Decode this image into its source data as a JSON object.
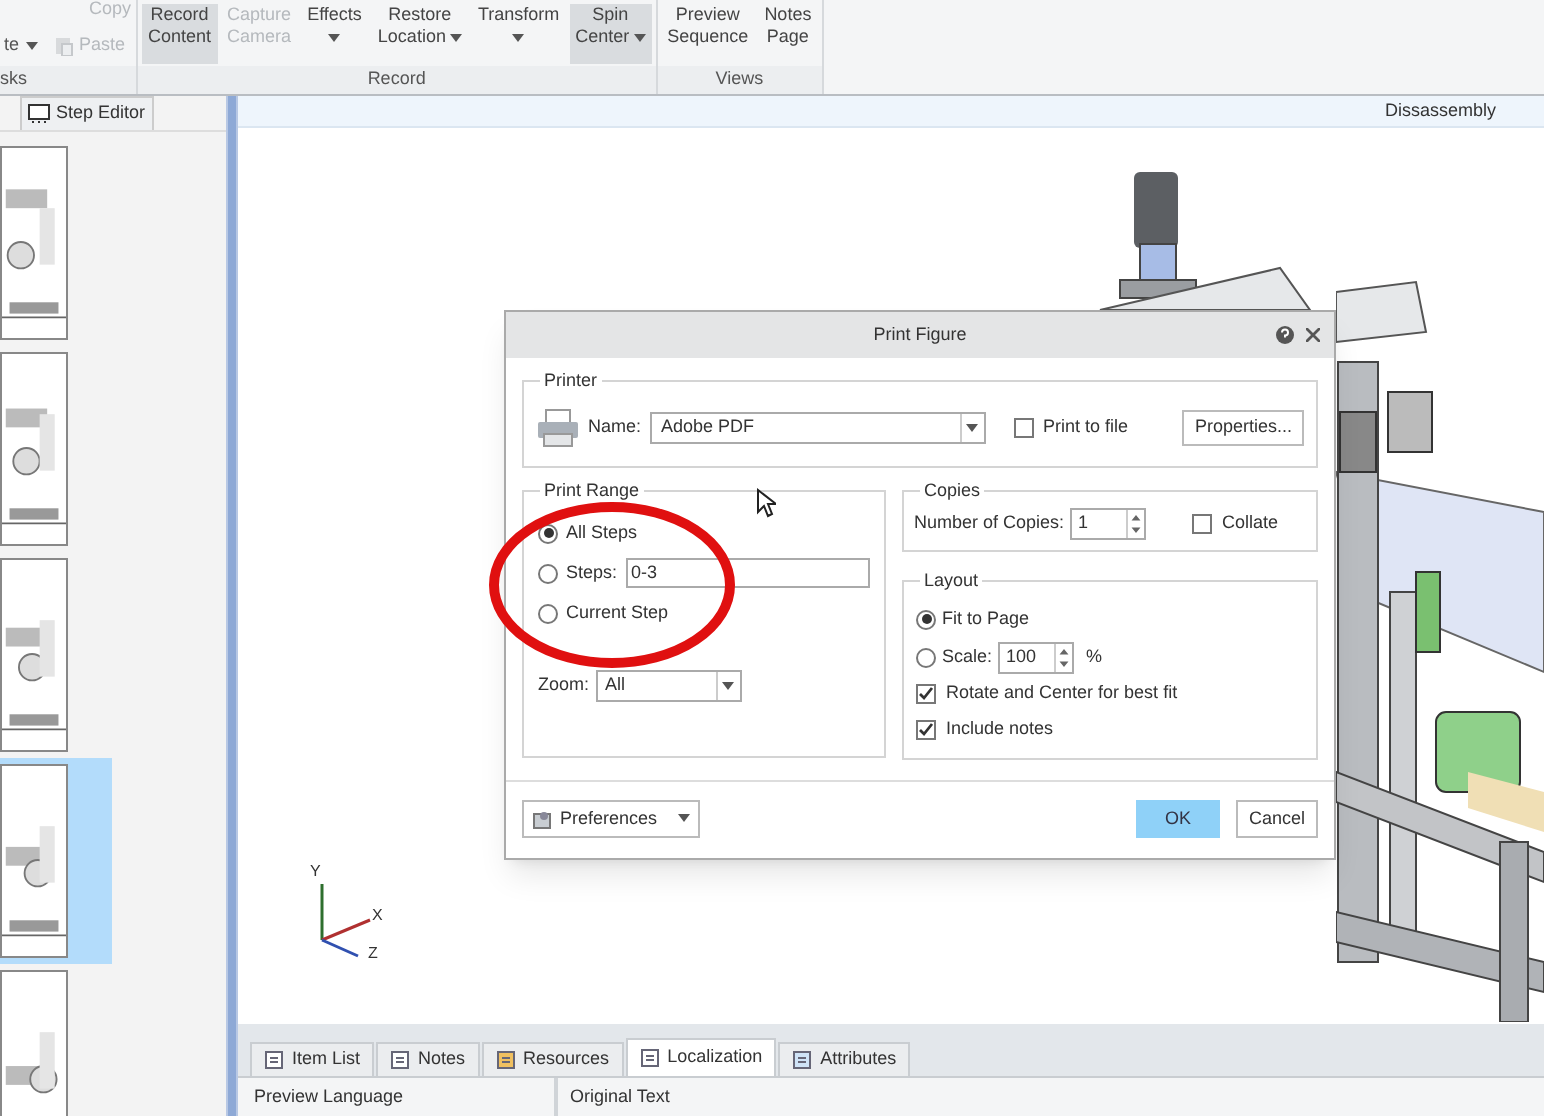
{
  "ribbon": {
    "groups": [
      {
        "label": "sks",
        "kind": "small",
        "buttons": [
          {
            "lines": [
              "Copy"
            ],
            "disabled": true,
            "dropdown": false
          },
          {
            "lines": [
              "te"
            ],
            "disabled": false,
            "dropdown": true
          },
          {
            "lines": [
              "Paste"
            ],
            "disabled": true,
            "dropdown": false
          }
        ]
      },
      {
        "label": "Record",
        "kind": "large",
        "buttons": [
          {
            "lines": [
              "Record",
              "Content"
            ],
            "selected": true,
            "disabled": false,
            "dropdown": false
          },
          {
            "lines": [
              "Capture",
              "Camera"
            ],
            "selected": false,
            "disabled": true,
            "dropdown": false
          },
          {
            "lines": [
              "Effects"
            ],
            "selected": false,
            "disabled": false,
            "dropdown": true
          },
          {
            "lines": [
              "Restore",
              "Location"
            ],
            "selected": false,
            "disabled": false,
            "dropdown": true
          },
          {
            "lines": [
              "Transform"
            ],
            "selected": false,
            "disabled": false,
            "dropdown": true
          },
          {
            "lines": [
              "Spin",
              "Center"
            ],
            "selected": true,
            "disabled": false,
            "dropdown": true
          }
        ]
      },
      {
        "label": "Views",
        "kind": "large",
        "buttons": [
          {
            "lines": [
              "Preview",
              "Sequence"
            ],
            "selected": false,
            "disabled": false,
            "dropdown": false
          },
          {
            "lines": [
              "Notes",
              "Page"
            ],
            "selected": false,
            "disabled": false,
            "dropdown": false
          }
        ]
      }
    ]
  },
  "left_panel": {
    "tab": "Step Editor",
    "thumbnails": [
      {
        "selected": false
      },
      {
        "selected": false
      },
      {
        "selected": false
      },
      {
        "selected": true
      },
      {
        "selected": false
      }
    ]
  },
  "viewport": {
    "title": "Dissassembly",
    "axes": [
      "Y",
      "X",
      "Z"
    ]
  },
  "dialog": {
    "title": "Print Figure",
    "printer": {
      "label": "Printer",
      "name_label": "Name:",
      "name_value": "Adobe PDF",
      "print_to_file": {
        "label": "Print to file",
        "checked": false
      },
      "properties_button": "Properties..."
    },
    "print_range": {
      "label": "Print Range",
      "options": [
        {
          "label": "All Steps",
          "selected": true
        },
        {
          "label": "Steps:",
          "selected": false,
          "value": "0-3"
        },
        {
          "label": "Current Step",
          "selected": false
        }
      ],
      "zoom_label": "Zoom:",
      "zoom_value": "All"
    },
    "copies": {
      "label": "Copies",
      "number_label": "Number of Copies:",
      "number_value": "1",
      "collate": {
        "label": "Collate",
        "checked": false
      }
    },
    "layout": {
      "label": "Layout",
      "options": [
        {
          "label": "Fit to Page",
          "selected": true
        },
        {
          "label": "Scale:",
          "selected": false,
          "value": "100",
          "unit": "%"
        }
      ],
      "checks": [
        {
          "label": "Rotate and Center for best fit",
          "checked": true
        },
        {
          "label": "Include notes",
          "checked": true
        }
      ]
    },
    "preferences_button": "Preferences",
    "ok_button": "OK",
    "cancel_button": "Cancel"
  },
  "bottom_panel": {
    "tabs": [
      {
        "label": "Item List",
        "selected": false
      },
      {
        "label": "Notes",
        "selected": false
      },
      {
        "label": "Resources",
        "selected": false
      },
      {
        "label": "Localization",
        "selected": true
      },
      {
        "label": "Attributes",
        "selected": false
      }
    ],
    "columns": [
      "Preview Language",
      "Original Text"
    ]
  }
}
